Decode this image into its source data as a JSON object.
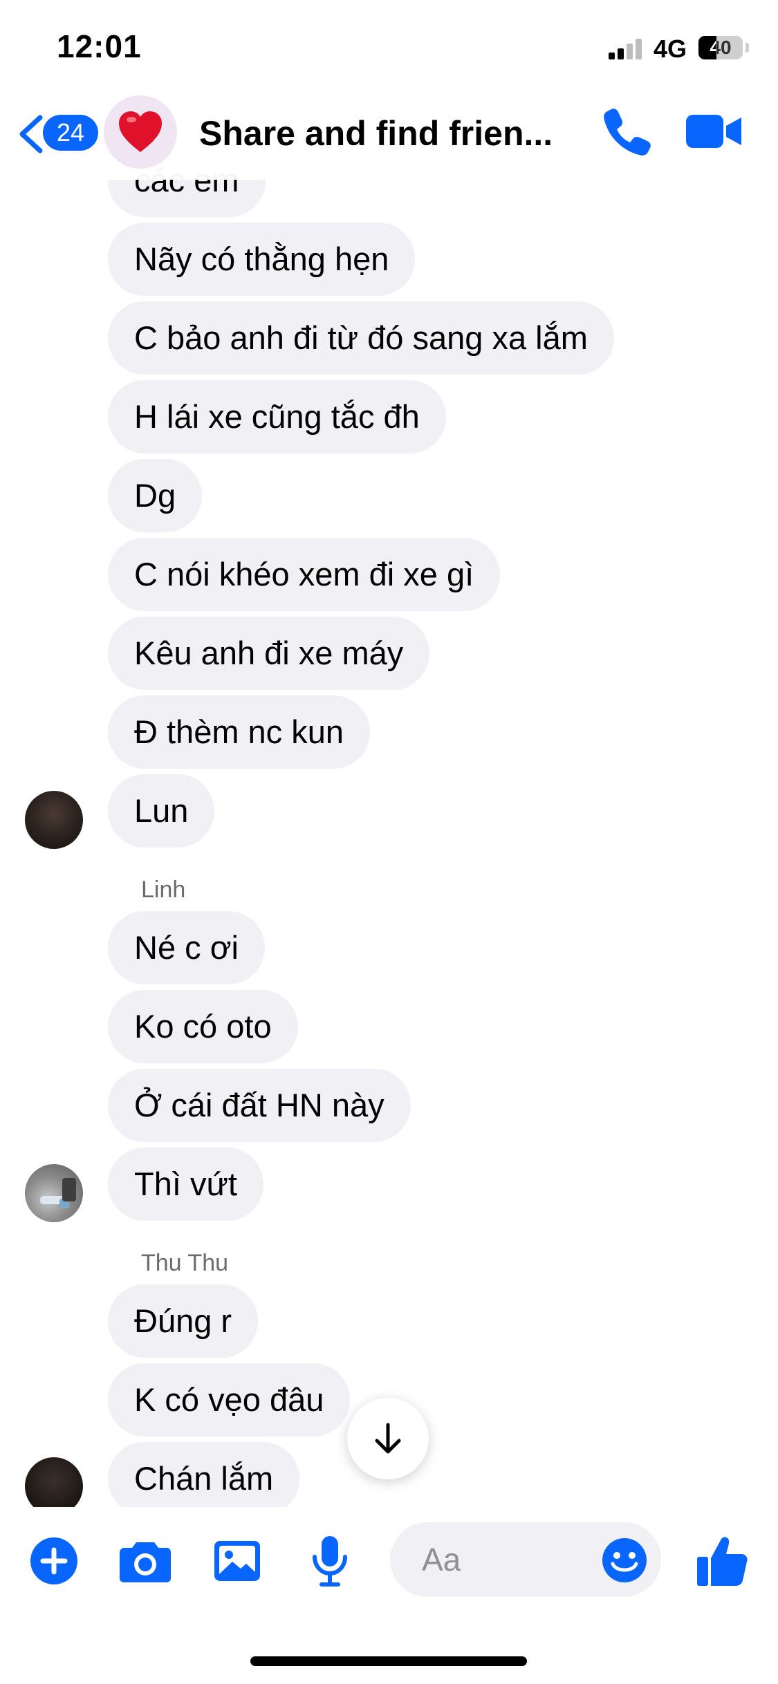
{
  "status_bar": {
    "time": "12:01",
    "network": "4G",
    "battery": "40"
  },
  "header": {
    "back_count": "24",
    "title": "Share and find frien..."
  },
  "composer": {
    "placeholder": "Aa"
  },
  "colors": {
    "accent": "#0866ff",
    "bubble": "#f0f0f5",
    "heart": "#e0112b"
  },
  "messages": [
    {
      "text": "các em"
    },
    {
      "text": "Nãy có thằng hẹn"
    },
    {
      "text": "C bảo anh đi từ đó sang xa lắm"
    },
    {
      "text": "H lái xe cũng tắc đh"
    },
    {
      "text": "Dg"
    },
    {
      "text": "C nói khéo xem đi xe gì"
    },
    {
      "text": "Kêu anh đi xe máy"
    },
    {
      "text": "Đ thèm nc kun"
    },
    {
      "text": "Lun"
    },
    {
      "text": "Né c ơi"
    },
    {
      "text": "Ko có oto"
    },
    {
      "text": "Ở cái đất HN này"
    },
    {
      "text": "Thì vứt"
    },
    {
      "text": "Đúng r"
    },
    {
      "text": "K có vẹo đâu"
    },
    {
      "text": "Chán lắm"
    }
  ],
  "senders": [
    {
      "name": "Linh"
    },
    {
      "name": "Thu Thu"
    }
  ]
}
